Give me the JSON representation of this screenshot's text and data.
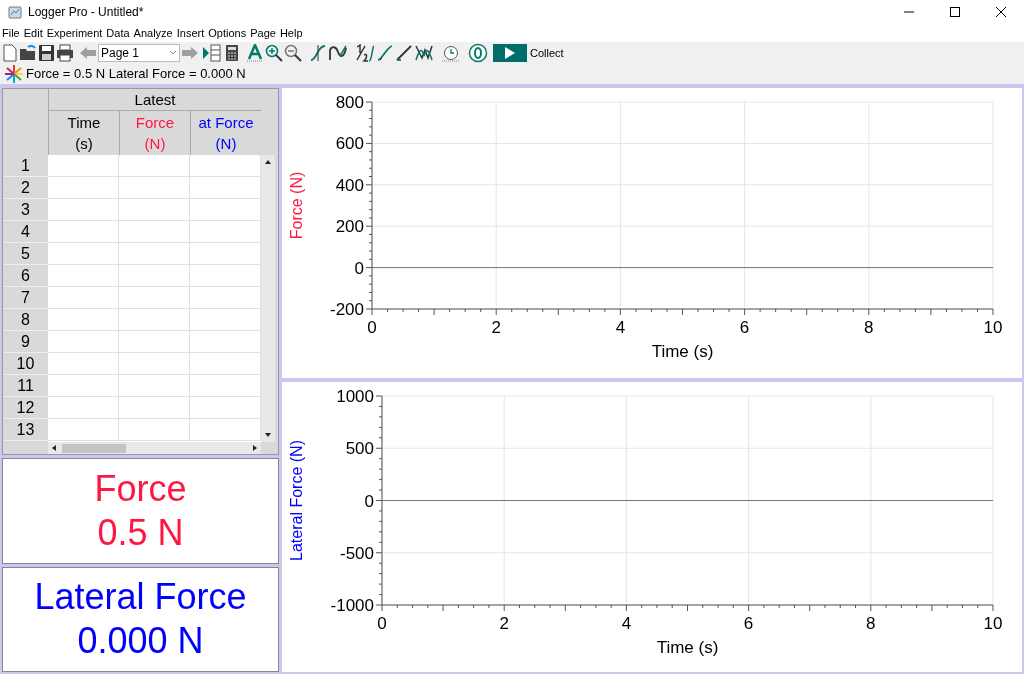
{
  "window": {
    "title": "Logger Pro - Untitled*"
  },
  "menu": [
    "File",
    "Edit",
    "Experiment",
    "Data",
    "Analyze",
    "Insert",
    "Options",
    "Page",
    "Help"
  ],
  "toolbar": {
    "page_select": {
      "value": "Page 1"
    },
    "collect_label": "Collect"
  },
  "status_line": "Force = 0.5 N Lateral Force = 0.000 N",
  "table": {
    "group_header": "Latest",
    "columns": [
      {
        "name": "Time",
        "unit": "(s)",
        "color": "#000000"
      },
      {
        "name": "Force",
        "unit": "(N)",
        "color": "#ff1744"
      },
      {
        "name": "at Force",
        "unit": "(N)",
        "color": "#0000ff"
      }
    ],
    "row_numbers": [
      "1",
      "2",
      "3",
      "4",
      "5",
      "6",
      "7",
      "8",
      "9",
      "10",
      "11",
      "12",
      "13"
    ]
  },
  "meters": [
    {
      "label": "Force",
      "reading": "0.5 N",
      "color": "#ff1744"
    },
    {
      "label": "Lateral Force",
      "reading": "0.000 N",
      "color": "#0000ff"
    }
  ],
  "graphs": [
    {
      "color": "#ff1744",
      "chart_data": {
        "type": "line",
        "grid": true,
        "xlabel": "Time (s)",
        "ylabel": "Force (N)",
        "xlim": [
          0,
          10
        ],
        "ylim": [
          -200,
          800
        ],
        "xticks": [
          0,
          2,
          4,
          6,
          8,
          10
        ],
        "yticks": [
          -200,
          0,
          200,
          400,
          600,
          800
        ]
      }
    },
    {
      "color": "#0000ff",
      "chart_data": {
        "type": "line",
        "grid": true,
        "xlabel": "Time (s)",
        "ylabel": "Lateral Force (N)",
        "xlim": [
          0,
          10
        ],
        "ylim": [
          -1000,
          1000
        ],
        "xticks": [
          0,
          2,
          4,
          6,
          8,
          10
        ],
        "yticks": [
          -1000,
          -500,
          0,
          500,
          1000
        ]
      }
    }
  ]
}
